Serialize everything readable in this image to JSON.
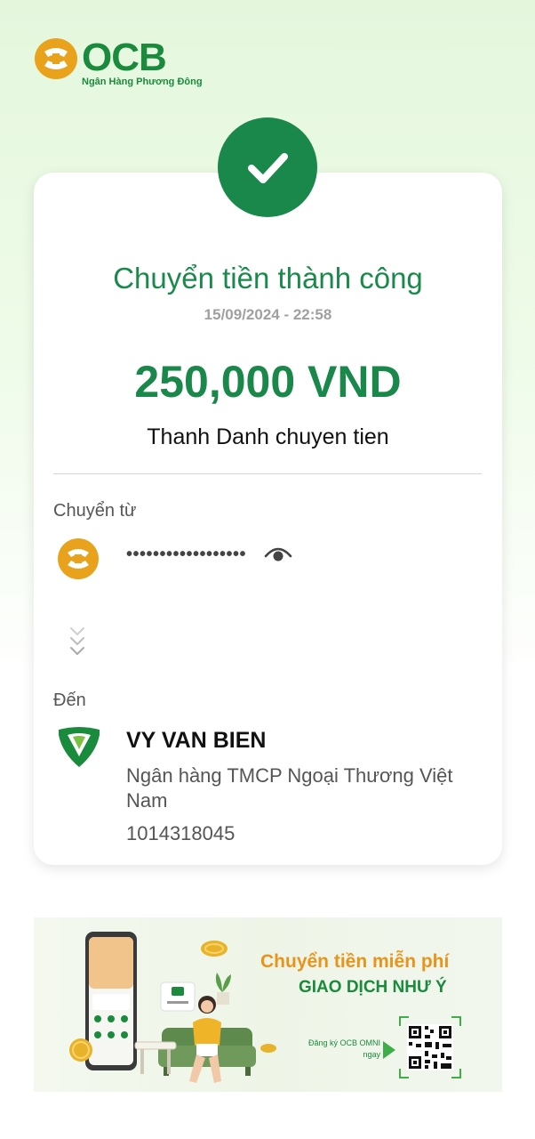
{
  "brand": {
    "name": "OCB",
    "tagline": "Ngân Hàng Phương Đông",
    "primary_color": "#19884a",
    "accent_color": "#e8a21c"
  },
  "receipt": {
    "title": "Chuyển tiền thành công",
    "datetime": "15/09/2024 - 22:58",
    "amount": "250,000 VND",
    "memo": "Thanh Danh chuyen tien",
    "from_label": "Chuyển từ",
    "from_account_masked": "••••••••••••••••••",
    "to_label": "Đến",
    "recipient_name": "VY VAN BIEN",
    "recipient_bank": "Ngân hàng TMCP Ngoại Thương Việt Nam",
    "recipient_account": "1014318045"
  },
  "icons": {
    "success": "check-circle-icon",
    "reveal": "eye-icon",
    "flow": "chevron-down-triple-icon"
  },
  "banner": {
    "headline": "Chuyển tiền miễn phí",
    "subheadline": "GIAO DỊCH NHƯ Ý",
    "cta": "Đăng ký OCB OMNI ngay"
  }
}
